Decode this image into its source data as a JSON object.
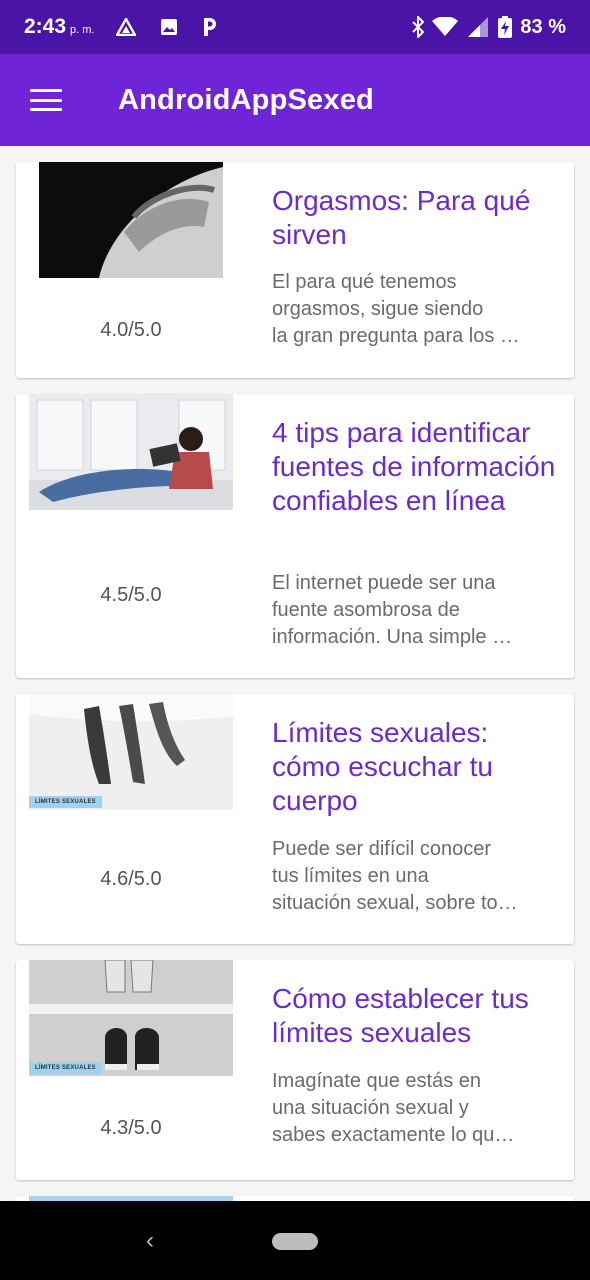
{
  "status": {
    "time": "2:43",
    "ampm": "p. m.",
    "battery": "83 %"
  },
  "app": {
    "title": "AndroidAppSexed"
  },
  "colors": {
    "statusbar": "#4a14a6",
    "appbar": "#6f24d8",
    "title_text": "#6d2bc9"
  },
  "articles": [
    {
      "title": "Orgasmos: Para qué sirven",
      "desc_lines": [
        "El para qué tenemos",
        "orgasmos, sigue siendo",
        "la gran pregunta para los …"
      ],
      "rating": "4.0/5.0",
      "tag": ""
    },
    {
      "title": "4 tips para identificar fuentes de información confiables en línea",
      "desc_lines": [
        "El internet puede ser una",
        "fuente asombrosa de",
        "información. Una simple …"
      ],
      "rating": "4.5/5.0",
      "tag": ""
    },
    {
      "title": "Límites sexuales: cómo escuchar tu cuerpo",
      "desc_lines": [
        "Puede ser difícil conocer",
        "tus límites en una",
        "situación sexual, sobre to…"
      ],
      "rating": "4.6/5.0",
      "tag": "LÍMITES SEXUALES"
    },
    {
      "title": "Cómo establecer tus límites sexuales",
      "desc_lines": [
        "Imagínate que estás en",
        "una situación sexual y",
        "sabes exactamente lo qu…"
      ],
      "rating": "4.3/5.0",
      "tag": "LÍMITES SEXUALES"
    }
  ]
}
